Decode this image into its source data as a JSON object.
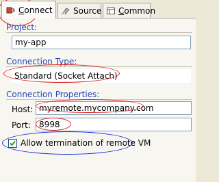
{
  "tabs": [
    {
      "label": "Connect",
      "mnemonic": "C",
      "rest": "onnect",
      "icon": "connect-icon"
    },
    {
      "label": "Source",
      "mnemonic": "",
      "rest": "Source",
      "icon": "source-icon"
    },
    {
      "label": "Common",
      "mnemonic": "C",
      "rest": "ommon",
      "icon": "common-icon"
    }
  ],
  "project": {
    "label": "Project:",
    "value": "my-app"
  },
  "connection_type": {
    "label": "Connection Type:",
    "value": "Standard (Socket Attach)"
  },
  "connection_properties": {
    "label": "Connection Properties:",
    "host_label": "Host:",
    "host_value": "myremote.mycompany.com",
    "port_label": "Port:",
    "port_value": "8998"
  },
  "allow_termination": {
    "label": "Allow termination of remote VM",
    "checked": true
  },
  "colors": {
    "annotation_red": "#e02020",
    "annotation_blue": "#1c2fd0",
    "group_label": "#2147b8"
  }
}
